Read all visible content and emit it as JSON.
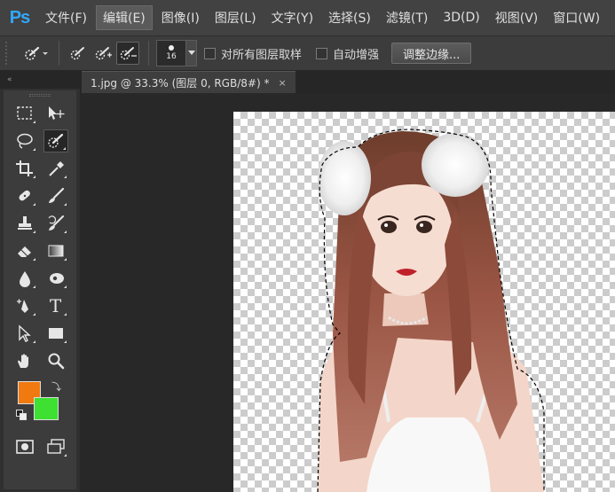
{
  "app": {
    "logo": "Ps"
  },
  "menu": {
    "items": [
      {
        "label": "文件(F)"
      },
      {
        "label": "编辑(E)"
      },
      {
        "label": "图像(I)"
      },
      {
        "label": "图层(L)"
      },
      {
        "label": "文字(Y)"
      },
      {
        "label": "选择(S)"
      },
      {
        "label": "滤镜(T)"
      },
      {
        "label": "3D(D)"
      },
      {
        "label": "视图(V)"
      },
      {
        "label": "窗口(W)"
      }
    ],
    "active_index": 1
  },
  "options": {
    "brush_size": "16",
    "sample_all_layers_label": "对所有图层取样",
    "auto_enhance_label": "自动增强",
    "refine_edge_label": "调整边缘...",
    "sample_all_layers_checked": false,
    "auto_enhance_checked": false
  },
  "toolbar": {
    "collapse_label": "«",
    "tools": [
      [
        "rect-marquee-icon",
        "move-icon"
      ],
      [
        "lasso-icon",
        "quick-selection-icon"
      ],
      [
        "crop-icon",
        "eyedropper-icon"
      ],
      [
        "spot-healing-icon",
        "brush-icon"
      ],
      [
        "clone-stamp-icon",
        "history-brush-icon"
      ],
      [
        "eraser-icon",
        "gradient-icon"
      ],
      [
        "blur-icon",
        "dodge-icon"
      ],
      [
        "pen-icon",
        "type-icon"
      ],
      [
        "path-selection-icon",
        "rectangle-shape-icon"
      ],
      [
        "hand-icon",
        "zoom-icon"
      ]
    ],
    "type_tool_glyph": "T",
    "selected_tool": "quick-selection-icon",
    "foreground_color": "#f07a10",
    "background_color": "#3ee032"
  },
  "document": {
    "tab_title": "1.jpg @ 33.3% (图层 0, RGB/8#) *",
    "close_glyph": "×"
  },
  "colors": {
    "accent_logo": "#31a8ff",
    "hair": "#8a4a3a",
    "skin": "#f2d8cc"
  }
}
